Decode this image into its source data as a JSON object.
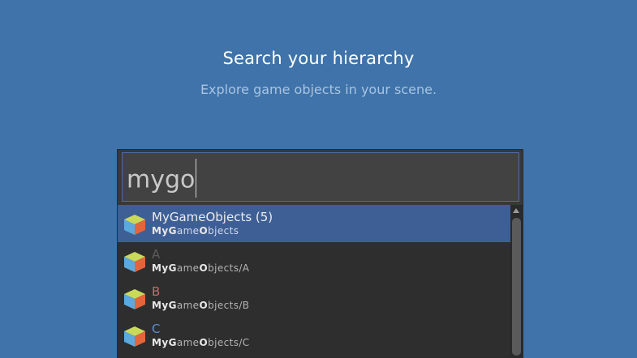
{
  "header": {
    "title": "Search your hierarchy",
    "subtitle": "Explore game objects in your scene."
  },
  "search": {
    "query": "mygo"
  },
  "results": [
    {
      "name": "MyGameObjects (5)",
      "name_color": "#ececec",
      "path": [
        "My",
        "G",
        "ame",
        "O",
        "bjects"
      ],
      "selected": true,
      "icon": "cube-icon"
    },
    {
      "name": "A",
      "name_color": "#5c5c5c",
      "path": [
        "My",
        "G",
        "ame",
        "O",
        "bjects/A"
      ],
      "selected": false,
      "icon": "cube-icon"
    },
    {
      "name": "B",
      "name_color": "#c76a6a",
      "path": [
        "My",
        "G",
        "ame",
        "O",
        "bjects/B"
      ],
      "selected": false,
      "icon": "cube-icon"
    },
    {
      "name": "C",
      "name_color": "#5e8fd0",
      "path": [
        "My",
        "G",
        "ame",
        "O",
        "bjects/C"
      ],
      "selected": false,
      "icon": "cube-icon"
    }
  ]
}
